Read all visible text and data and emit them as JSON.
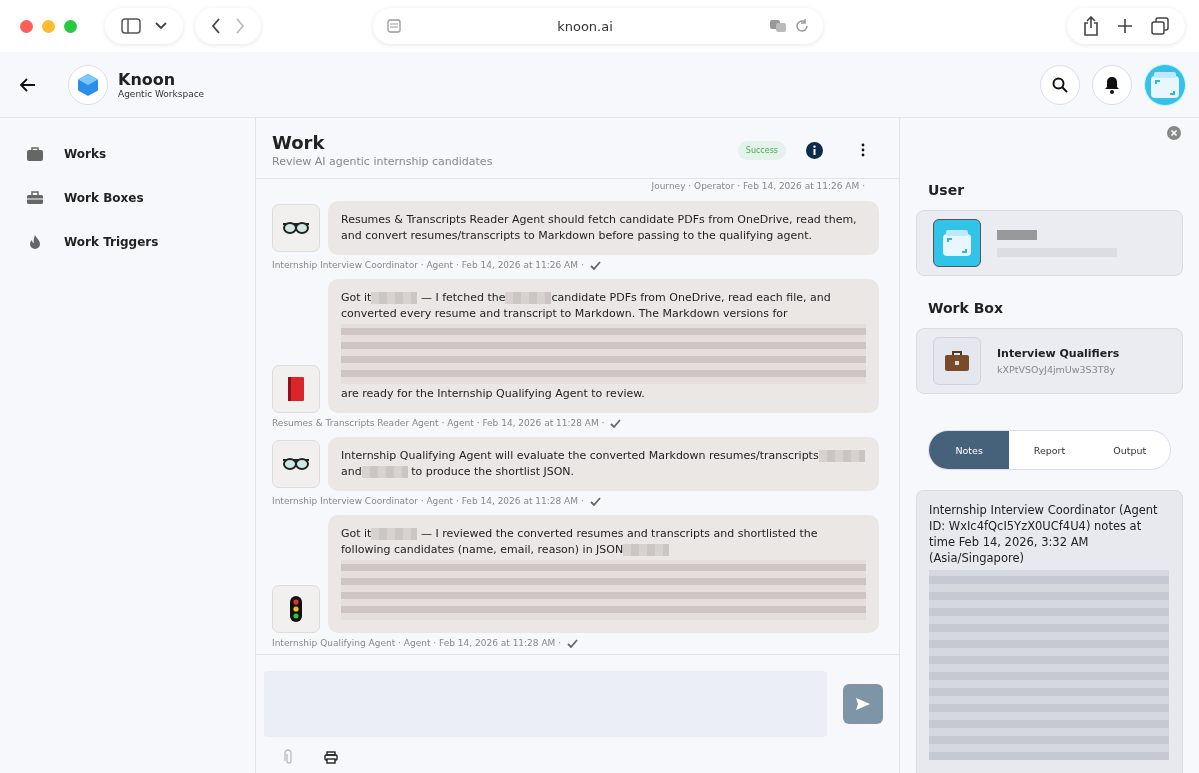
{
  "browser": {
    "url": "knoon.ai"
  },
  "app": {
    "name": "Knoon",
    "tagline": "Agentic Workspace"
  },
  "sidebar": {
    "items": [
      {
        "label": "Works"
      },
      {
        "label": "Work Boxes"
      },
      {
        "label": "Work Triggers"
      }
    ]
  },
  "work": {
    "title": "Work",
    "subtitle": "Review AI agentic internship candidates",
    "status": "Success",
    "previous_meta": "Journey · Operator · Feb 14, 2026 at 11:26 AM ·",
    "messages": [
      {
        "kind": "coordinator",
        "meta": "Internship Interview Coordinator · Agent · Feb 14, 2026 at 11:26 AM ·",
        "parts": [
          {
            "kind": "text",
            "text": "Resumes & Transcripts Reader Agent should fetch candidate PDFs from OneDrive, read them, and convert resumes/transcripts to Markdown before passing to the qualifying agent."
          }
        ]
      },
      {
        "kind": "reader",
        "meta": "Resumes & Transcripts Reader Agent · Agent · Feb 14, 2026 at 11:28 AM ·",
        "parts": [
          {
            "kind": "text",
            "text": "Got it"
          },
          {
            "kind": "redaction"
          },
          {
            "kind": "text",
            "text": " — I fetched the"
          },
          {
            "kind": "redaction"
          },
          {
            "kind": "text",
            "text": "candidate PDFs from OneDrive, read each file, and converted every resume and transcript to Markdown. The Markdown versions for "
          },
          {
            "kind": "redaction-block"
          },
          {
            "kind": "text",
            "text": "are ready for the Internship Qualifying Agent to review."
          }
        ]
      },
      {
        "kind": "coordinator",
        "meta": "Internship Interview Coordinator · Agent · Feb 14, 2026 at 11:28 AM ·",
        "parts": [
          {
            "kind": "text",
            "text": "Internship Qualifying Agent will evaluate the converted Markdown resumes/transcripts"
          },
          {
            "kind": "redaction"
          },
          {
            "kind": "text",
            "text": "and"
          },
          {
            "kind": "redaction"
          },
          {
            "kind": "text",
            "text": " to produce the shortlist JSON."
          }
        ]
      },
      {
        "kind": "qualifier",
        "meta": "Internship Qualifying Agent · Agent · Feb 14, 2026 at 11:28 AM ·",
        "parts": [
          {
            "kind": "text",
            "text": "Got it"
          },
          {
            "kind": "redaction"
          },
          {
            "kind": "text",
            "text": " — I reviewed the converted resumes and transcripts and shortlisted the following candidates (name, email, reason) in JSON"
          },
          {
            "kind": "redaction"
          },
          {
            "kind": "redaction-block"
          }
        ]
      }
    ]
  },
  "panel": {
    "user_heading": "User",
    "workbox_heading": "Work Box",
    "workbox_name": "Interview Qualifiers",
    "workbox_id": "kXPtVSOyJ4jmUw3S3T8y",
    "tabs": [
      {
        "label": "Notes",
        "selected": true
      },
      {
        "label": "Report",
        "selected": false
      },
      {
        "label": "Output",
        "selected": false
      }
    ],
    "notes": "Internship Interview Coordinator (Agent ID: WxIc4fQcI5YzX0UCf4U4) notes at time Feb 14, 2026, 3:32 AM (Asia/Singapore)"
  }
}
